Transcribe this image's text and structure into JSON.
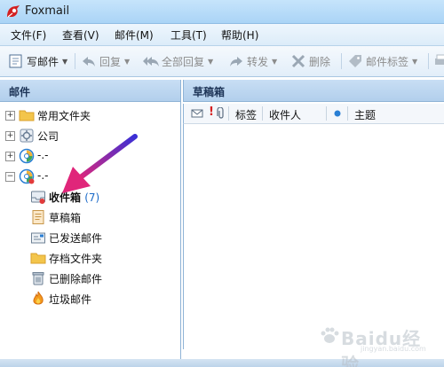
{
  "window": {
    "title": "Foxmail"
  },
  "menu": [
    {
      "label": "文件(F)"
    },
    {
      "label": "查看(V)"
    },
    {
      "label": "邮件(M)"
    },
    {
      "label": "工具(T)"
    },
    {
      "label": "帮助(H)"
    }
  ],
  "toolbar": {
    "write": "写邮件",
    "reply": "回复",
    "reply_all": "全部回复",
    "forward": "转发",
    "delete": "删除",
    "tag": "邮件标签"
  },
  "left_panel": {
    "header": "邮件",
    "tree": [
      {
        "label": "常用文件夹",
        "icon": "folder-icon"
      },
      {
        "label": "公司",
        "icon": "company-account-icon"
      },
      {
        "label": "-.-",
        "icon": "account-icon"
      },
      {
        "label": "-.-",
        "icon": "account-icon"
      },
      {
        "label": "收件箱",
        "count": "(7)",
        "icon": "inbox-icon"
      },
      {
        "label": "草稿箱",
        "icon": "drafts-icon"
      },
      {
        "label": "已发送邮件",
        "icon": "sent-icon"
      },
      {
        "label": "存档文件夹",
        "icon": "archive-folder-icon"
      },
      {
        "label": "已删除邮件",
        "icon": "trash-icon"
      },
      {
        "label": "垃圾邮件",
        "icon": "spam-icon"
      }
    ]
  },
  "right_panel": {
    "header": "草稿箱",
    "columns": {
      "tag": "标签",
      "recipient": "收件人",
      "subject": "主题"
    }
  },
  "colors": {
    "accent": "#1a6ac8",
    "arrow": "#e0267a",
    "titlebar": "#aad4f6"
  },
  "watermark": {
    "text": "Baidu经验",
    "sub": "jingyan.baidu.com"
  }
}
